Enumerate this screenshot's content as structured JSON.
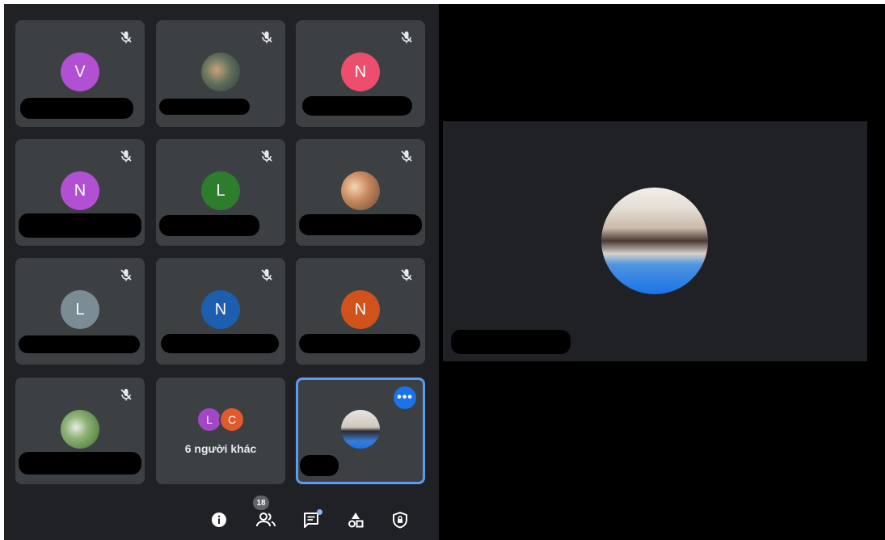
{
  "participants": [
    {
      "initial": "V",
      "color": "#b150d3",
      "type": "letter",
      "muted": true
    },
    {
      "initial": "",
      "color": "#7a8b7a",
      "type": "photo",
      "muted": true
    },
    {
      "initial": "N",
      "color": "#ee4e6e",
      "type": "letter",
      "muted": true
    },
    {
      "initial": "N",
      "color": "#b150d3",
      "type": "letter",
      "muted": true
    },
    {
      "initial": "L",
      "color": "#2d7d2d",
      "type": "letter",
      "muted": true
    },
    {
      "initial": "",
      "color": "#c98a60",
      "type": "photo",
      "muted": true
    },
    {
      "initial": "L",
      "color": "#7b8c95",
      "type": "letter",
      "muted": true
    },
    {
      "initial": "N",
      "color": "#1d5fae",
      "type": "letter",
      "muted": true
    },
    {
      "initial": "N",
      "color": "#d1521a",
      "type": "letter",
      "muted": true
    },
    {
      "initial": "",
      "color": "#4a7f36",
      "type": "photo",
      "muted": true
    }
  ],
  "others_tile": {
    "avatars": [
      {
        "initial": "L",
        "color": "#a346c8"
      },
      {
        "initial": "C",
        "color": "#e15a2b"
      }
    ],
    "label": "6 người khác"
  },
  "self_tile": {
    "type": "photo",
    "more_icon": "more-horiz-icon"
  },
  "toolbar": {
    "info_icon": "info-icon",
    "people_icon": "people-icon",
    "people_count": "18",
    "chat_icon": "chat-icon",
    "activities_icon": "activities-icon",
    "host_controls_icon": "shield-lock-icon"
  },
  "spotlight": {
    "type": "photo"
  }
}
